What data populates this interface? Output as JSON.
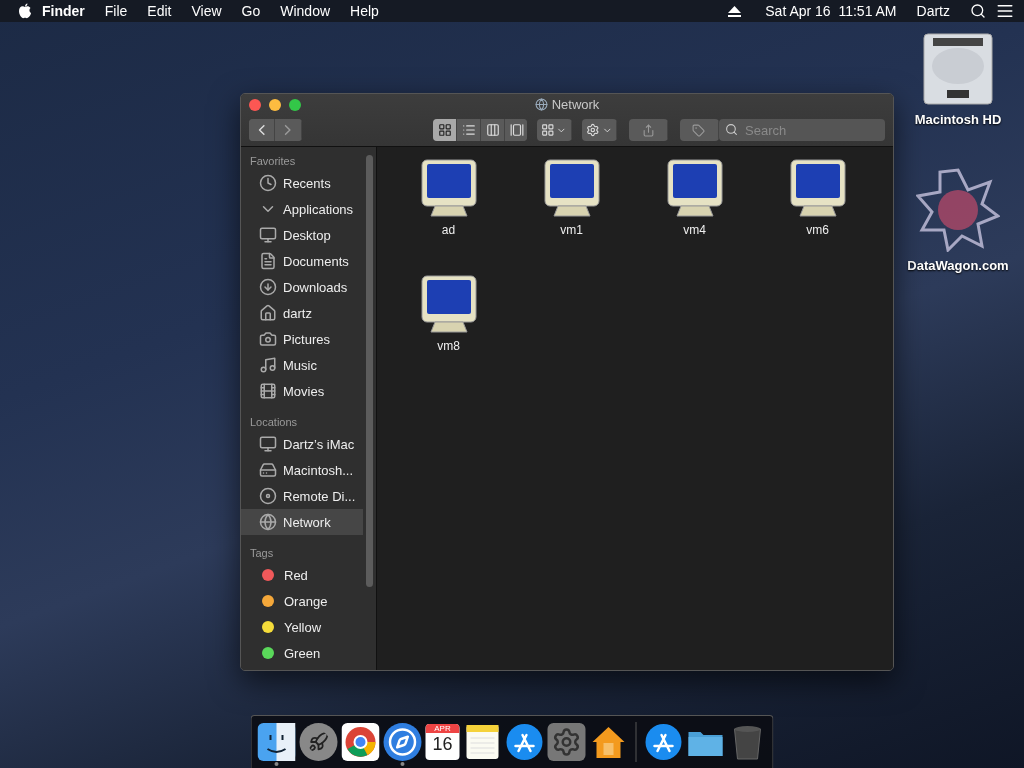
{
  "menu_bar": {
    "app": "Finder",
    "menus": [
      "File",
      "Edit",
      "View",
      "Go",
      "Window",
      "Help"
    ],
    "clock": "Sat Apr 16  11:51 AM",
    "user": "Dartz"
  },
  "desktop_icons": [
    {
      "kind": "disk",
      "label": "Macintosh HD"
    },
    {
      "kind": "logo",
      "label": "DataWagon.com"
    }
  ],
  "window": {
    "title": "Network",
    "toolbar": {
      "views": [
        {
          "kind": "icons",
          "selected": true
        },
        {
          "kind": "list",
          "selected": false
        },
        {
          "kind": "columns",
          "selected": false
        },
        {
          "kind": "gallery",
          "selected": false
        }
      ],
      "search": {
        "placeholder": "Search"
      }
    },
    "sidebar": [
      {
        "heading": "Favorites",
        "items": [
          {
            "kind": "recents",
            "label": "Recents",
            "selected": false
          },
          {
            "kind": "applications",
            "label": "Applications",
            "selected": false
          },
          {
            "kind": "desktop",
            "label": "Desktop",
            "selected": false
          },
          {
            "kind": "documents",
            "label": "Documents",
            "selected": false
          },
          {
            "kind": "downloads",
            "label": "Downloads",
            "selected": false
          },
          {
            "kind": "home",
            "label": "dartz",
            "selected": false
          },
          {
            "kind": "pictures",
            "label": "Pictures",
            "selected": false
          },
          {
            "kind": "music",
            "label": "Music",
            "selected": false
          },
          {
            "kind": "movies",
            "label": "Movies",
            "selected": false
          }
        ]
      },
      {
        "heading": "Locations",
        "items": [
          {
            "kind": "computer",
            "label": "Dartz’s iMac",
            "selected": false
          },
          {
            "kind": "disk",
            "label": "Macintosh...",
            "selected": false
          },
          {
            "kind": "disc",
            "label": "Remote Di...",
            "selected": false
          },
          {
            "kind": "network",
            "label": "Network",
            "selected": true
          }
        ]
      },
      {
        "heading": "Tags",
        "items": [
          {
            "kind": "tag",
            "label": "Red",
            "color": "#f0595a",
            "selected": false
          },
          {
            "kind": "tag",
            "label": "Orange",
            "color": "#f5a83a",
            "selected": false
          },
          {
            "kind": "tag",
            "label": "Yellow",
            "color": "#f5dc3a",
            "selected": false
          },
          {
            "kind": "tag",
            "label": "Green",
            "color": "#5ad85a",
            "selected": false
          }
        ]
      }
    ],
    "files": [
      {
        "name": "ad"
      },
      {
        "name": "vm1"
      },
      {
        "name": "vm4"
      },
      {
        "name": "vm6"
      },
      {
        "name": "vm8"
      }
    ]
  },
  "dock": [
    {
      "kind": "finder",
      "running": true
    },
    {
      "kind": "launchpad",
      "running": false
    },
    {
      "kind": "chrome",
      "running": false
    },
    {
      "kind": "safari",
      "running": true
    },
    {
      "kind": "calendar",
      "running": false,
      "month": "APR",
      "day": "16"
    },
    {
      "kind": "notes",
      "running": false
    },
    {
      "kind": "appstore",
      "running": false
    },
    {
      "kind": "settings",
      "running": false
    },
    {
      "kind": "home",
      "running": false
    },
    {
      "kind": "separator"
    },
    {
      "kind": "appstore",
      "running": false
    },
    {
      "kind": "folder",
      "running": false
    },
    {
      "kind": "trash",
      "running": false
    }
  ]
}
